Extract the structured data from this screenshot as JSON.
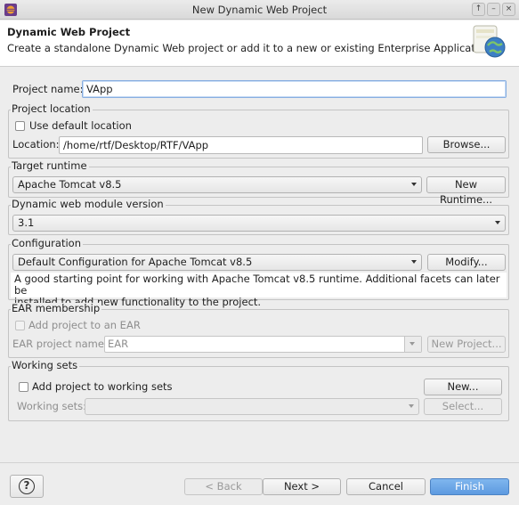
{
  "window": {
    "title": "New Dynamic Web Project",
    "controls": [
      "↑",
      "–",
      "×"
    ]
  },
  "banner": {
    "title": "Dynamic Web Project",
    "description": "Create a standalone Dynamic Web project or add it to a new or existing Enterprise Application."
  },
  "project_name": {
    "label": "Project name:",
    "value": "VApp"
  },
  "project_location": {
    "group_label": "Project location",
    "use_default_label": "Use default location",
    "use_default_checked": false,
    "location_label": "Location:",
    "location_value": "/home/rtf/Desktop/RTF/VApp",
    "browse_label": "Browse..."
  },
  "target_runtime": {
    "group_label": "Target runtime",
    "selected": "Apache Tomcat v8.5",
    "new_runtime_label": "New Runtime..."
  },
  "module_version": {
    "group_label": "Dynamic web module version",
    "selected": "3.1"
  },
  "configuration": {
    "group_label": "Configuration",
    "selected": "Default Configuration for Apache Tomcat v8.5",
    "modify_label": "Modify...",
    "description_line1": "A good starting point for working with Apache Tomcat v8.5 runtime. Additional facets can later be",
    "description_line2": "installed to add new functionality to the project."
  },
  "ear": {
    "group_label": "EAR membership",
    "add_label": "Add project to an EAR",
    "project_name_label": "EAR project name:",
    "project_name_value": "EAR",
    "new_project_label": "New Project..."
  },
  "working_sets": {
    "group_label": "Working sets",
    "add_label": "Add project to working sets",
    "new_label": "New...",
    "sets_label": "Working sets:",
    "sets_value": "",
    "select_label": "Select..."
  },
  "footer": {
    "help_glyph": "?",
    "back_label": "< Back",
    "next_label": "Next >",
    "cancel_label": "Cancel",
    "finish_label": "Finish"
  },
  "colors": {
    "primary_button": "#5d9ae0",
    "focus_border": "#88aee0"
  }
}
